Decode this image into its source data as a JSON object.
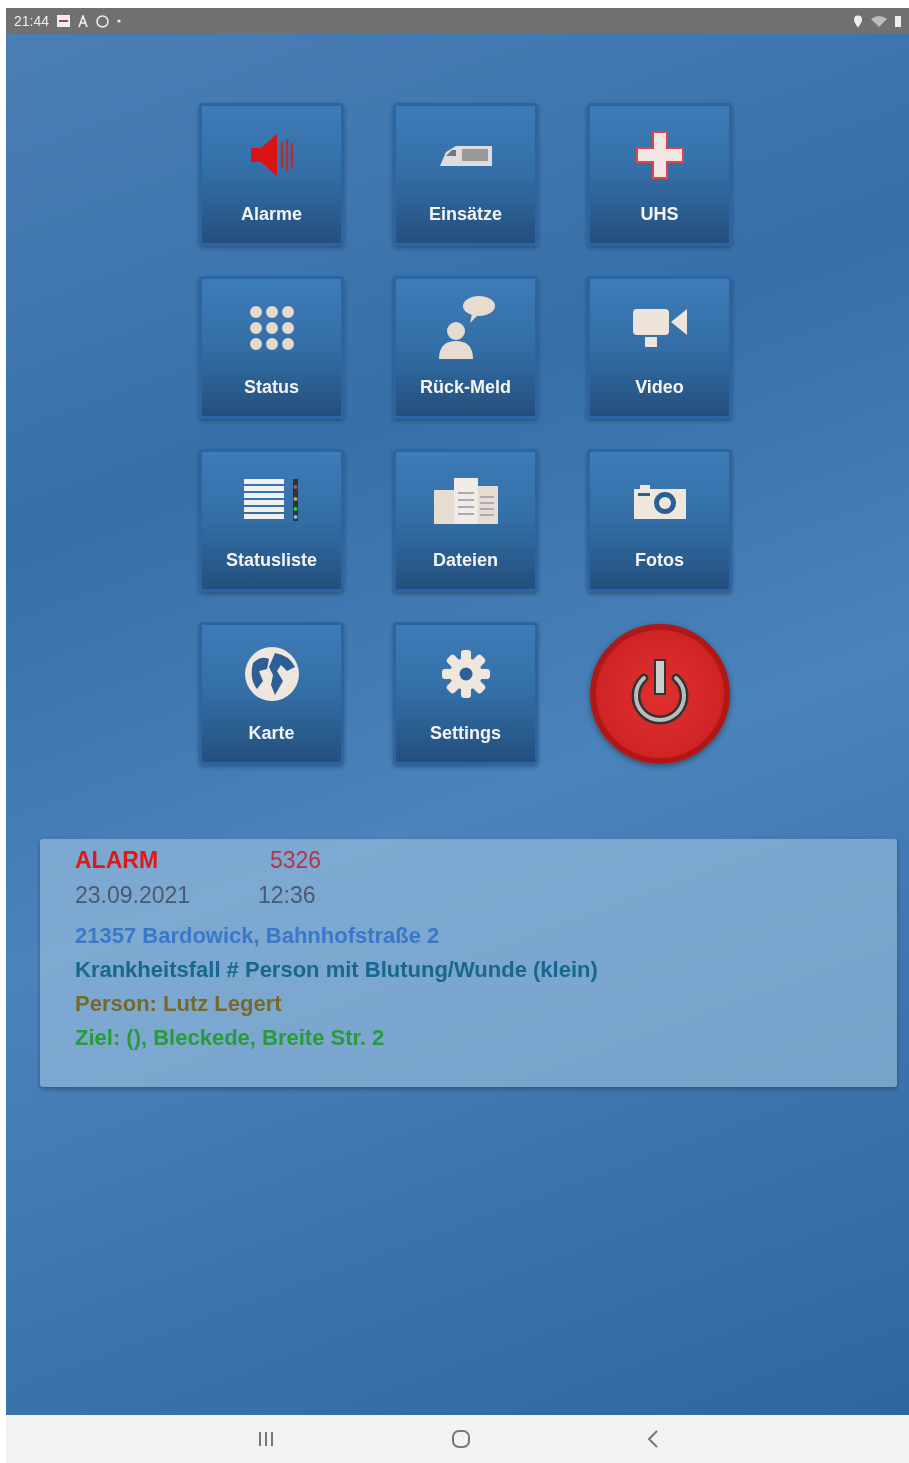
{
  "status_bar": {
    "time": "21:44"
  },
  "tiles": [
    {
      "kind": "speaker",
      "label": "Alarme"
    },
    {
      "kind": "vehicle",
      "label": "Einsätze"
    },
    {
      "kind": "cross",
      "label": "UHS"
    },
    {
      "kind": "keypad",
      "label": "Status"
    },
    {
      "kind": "person-speech",
      "label": "Rück-Meld"
    },
    {
      "kind": "video",
      "label": "Video"
    },
    {
      "kind": "list",
      "label": "Statusliste"
    },
    {
      "kind": "documents",
      "label": "Dateien"
    },
    {
      "kind": "camera",
      "label": "Fotos"
    },
    {
      "kind": "globe",
      "label": "Karte"
    },
    {
      "kind": "gear",
      "label": "Settings"
    },
    {
      "kind": "power"
    }
  ],
  "alarm": {
    "label": "ALARM",
    "number": "5326",
    "date": "23.09.2021",
    "time": "12:36"
  },
  "details": [
    {
      "text": "21357 Bardowick, Bahnhofstraße 2",
      "color": "#3a78c8"
    },
    {
      "text": "Krankheitsfall # Person mit Blutung/Wunde (klein)",
      "color": "#17688c"
    },
    {
      "text": "Person: Lutz Legert",
      "color": "#756a2a"
    },
    {
      "text": "Ziel: (), Bleckede, Breite Str. 2",
      "color": "#2a9a3a"
    }
  ]
}
